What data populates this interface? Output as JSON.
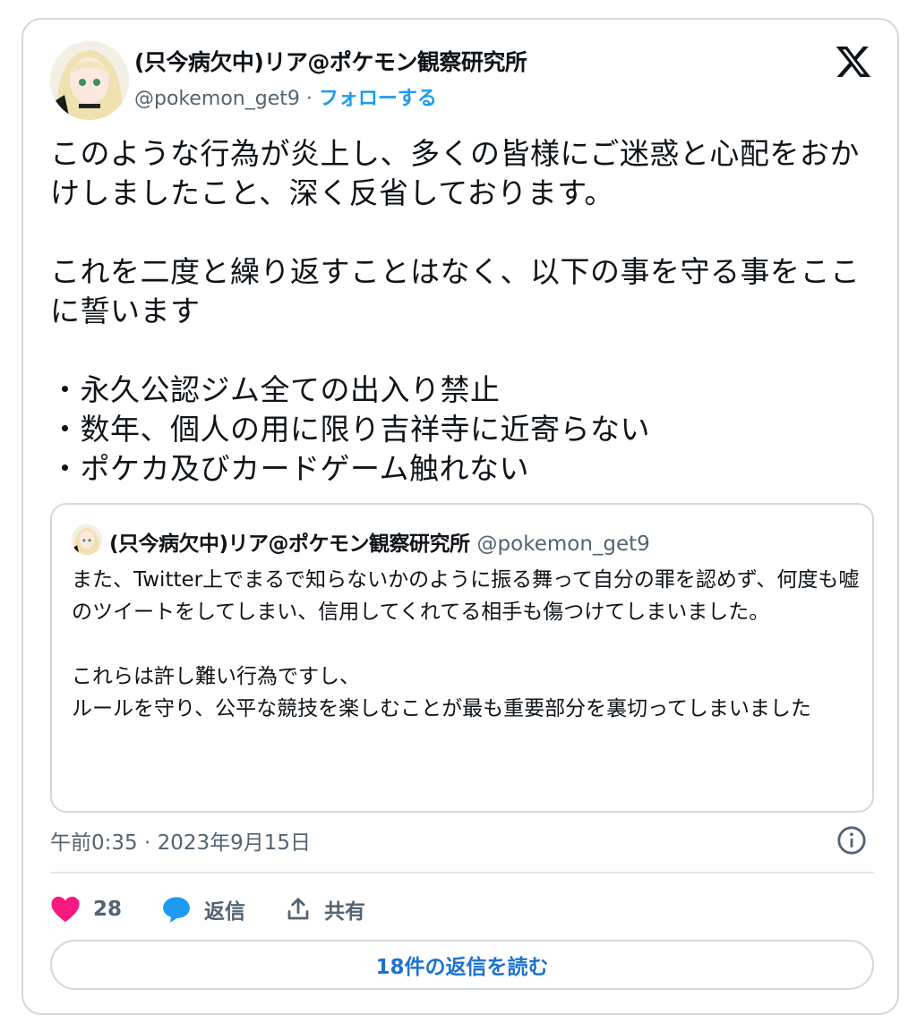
{
  "author": {
    "name": "(只今病欠中)リア@ポケモン観察研究所",
    "handle": "@pokemon_get9",
    "separator": "·",
    "follow_label": "フォローする"
  },
  "tweet": {
    "text": "このような行為が炎上し、多くの皆様にご迷惑と心配をおかけしましたこと、深く反省しております。\n\nこれを二度と繰り返すことはなく、以下の事を守る事をここに誓います\n\n・永久公認ジム全ての出入り禁止\n・数年、個人の用に限り吉祥寺に近寄らない\n・ポケカ及びカードゲーム触れない"
  },
  "quote": {
    "name": "(只今病欠中)リア@ポケモン観察研究所",
    "handle": "@pokemon_get9",
    "text": "また、Twitter上でまるで知らないかのように振る舞って自分の罪を認めず、何度も嘘のツイートをしてしまい、信用してくれてる相手も傷つけてしまいました。\n\nこれらは許し難い行為ですし、\nルールを守り、公平な競技を楽しむことが最も重要部分を裏切ってしまいました"
  },
  "meta": {
    "timestamp": "午前0:35 · 2023年9月15日"
  },
  "actions": {
    "likes_count": "28",
    "reply_label": "返信",
    "share_label": "共有"
  },
  "read_replies_label": "18件の返信を読む",
  "icons": {
    "logo": "x-logo-icon",
    "like": "heart-icon",
    "reply": "speech-bubble-icon",
    "share": "share-upload-icon",
    "info": "info-icon"
  },
  "colors": {
    "accent": "#1d9bf0",
    "like": "#f91880",
    "reply": "#1d9bf0",
    "muted": "#536471",
    "border": "#cfd9de"
  }
}
